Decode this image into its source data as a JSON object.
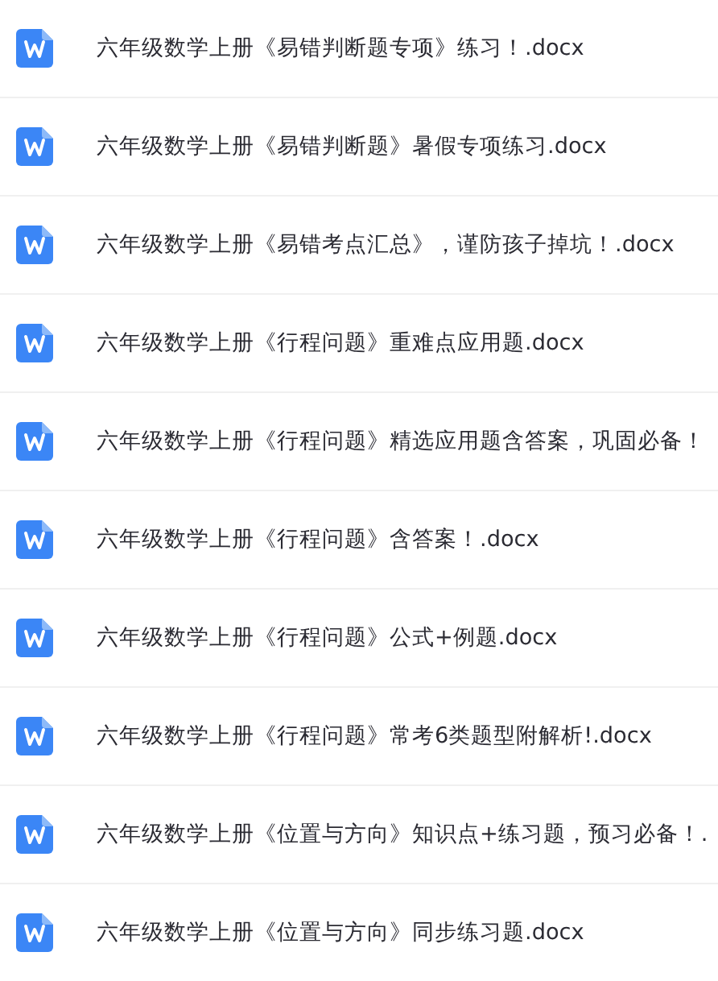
{
  "files": [
    {
      "name": "六年级数学上册《易错判断题专项》练习！.docx",
      "kind": "word"
    },
    {
      "name": "六年级数学上册《易错判断题》暑假专项练习.docx",
      "kind": "word"
    },
    {
      "name": "六年级数学上册《易错考点汇总》，谨防孩子掉坑！.docx",
      "kind": "word"
    },
    {
      "name": "六年级数学上册《行程问题》重难点应用题.docx",
      "kind": "word"
    },
    {
      "name": "六年级数学上册《行程问题》精选应用题含答案，巩固必备！",
      "kind": "word"
    },
    {
      "name": "六年级数学上册《行程问题》含答案！.docx",
      "kind": "word"
    },
    {
      "name": "六年级数学上册《行程问题》公式+例题.docx",
      "kind": "word"
    },
    {
      "name": "六年级数学上册《行程问题》常考6类题型附解析!.docx",
      "kind": "word"
    },
    {
      "name": "六年级数学上册《位置与方向》知识点+练习题，预习必备！.",
      "kind": "word"
    },
    {
      "name": "六年级数学上册《位置与方向》同步练习题.docx",
      "kind": "word"
    }
  ]
}
